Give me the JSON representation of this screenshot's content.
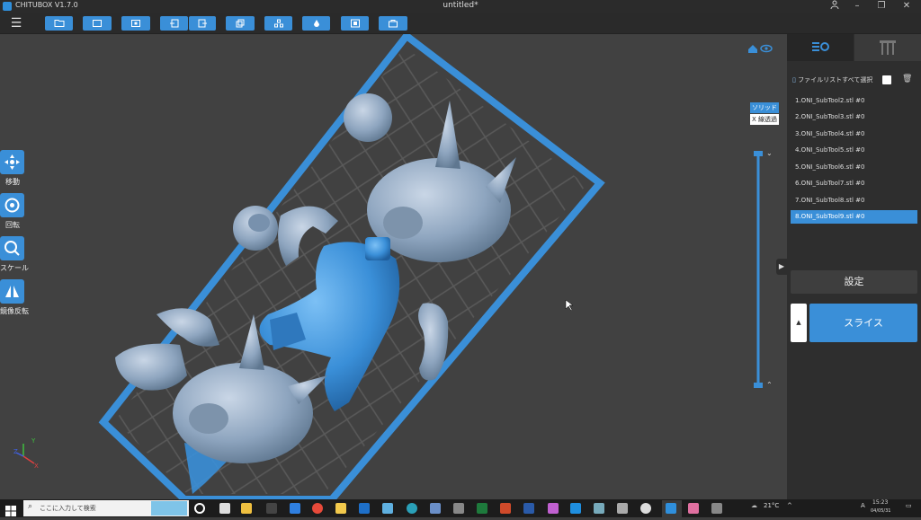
{
  "app": {
    "name": "CHITUBOX V1.7.0",
    "document_title": "untitled*"
  },
  "window_controls": {
    "user_icon": "user-icon",
    "minimize": "–",
    "restore": "❐",
    "close": "✕"
  },
  "toolbar": {
    "menu_icon": "☰",
    "tools": [
      "open-file-icon",
      "save-icon",
      "screenshot-icon",
      "import-icon",
      "export-icon",
      "copy-icon",
      "layout-icon",
      "drop-icon",
      "center-icon",
      "bag-icon"
    ]
  },
  "left_tools": [
    {
      "label": "移動",
      "icon": "move-icon"
    },
    {
      "label": "回転",
      "icon": "rotate-icon"
    },
    {
      "label": "スケール",
      "icon": "scale-icon"
    },
    {
      "label": "鏡像反転",
      "icon": "mirror-icon"
    }
  ],
  "view_modes": {
    "solid": "ソリッド",
    "xray": "X 線透過"
  },
  "axes": {
    "x": "X",
    "y": "Y",
    "z": "Z"
  },
  "panel": {
    "select_all_label": "ファイルリストすべて選択",
    "files": [
      "1.ONI_SubTool2.stl #0",
      "2.ONI_SubTool3.stl #0",
      "3.ONI_SubTool4.stl #0",
      "4.ONI_SubTool5.stl #0",
      "5.ONI_SubTool6.stl #0",
      "6.ONI_SubTool7.stl #0",
      "7.ONI_SubTool8.stl #0",
      "8.ONI_SubTool9.stl #0"
    ],
    "selected_index": 7,
    "settings_label": "設定",
    "slice_label": "スライス",
    "slice_expand": "▲",
    "collapse_handle": "▶"
  },
  "layer_slider": {
    "up": "⌃",
    "down": "⌄"
  },
  "taskbar": {
    "search_placeholder": "ここに入力して検索",
    "temperature": "21°C",
    "ime": "A",
    "time": "15:23",
    "date": "04/05/31"
  },
  "colors": {
    "accent": "#3a8fd8",
    "model": "#8fa6c0",
    "model_selected": "#3e8fd6",
    "plate_border": "#3a8fd8"
  }
}
